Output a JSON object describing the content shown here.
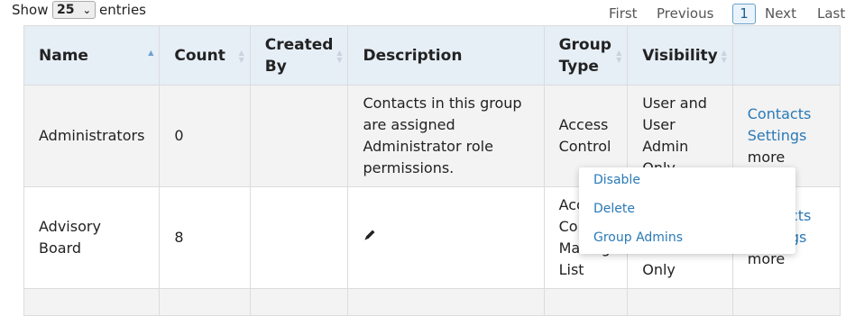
{
  "length_control": {
    "show_label": "Show",
    "value": "25",
    "entries_label": "entries"
  },
  "pagination": {
    "first": "First",
    "previous": "Previous",
    "current": "1",
    "next": "Next",
    "last": "Last"
  },
  "table": {
    "headers": {
      "name": "Name",
      "count": "Count",
      "created_by_line1": "Created",
      "created_by_line2": "By",
      "description": "Description",
      "group_type_line1": "Group",
      "group_type_line2": "Type",
      "visibility": "Visibility"
    },
    "rows": [
      {
        "name": "Administrators",
        "count": "0",
        "created_by": "",
        "description": "Contacts in this group are assigned Administrator role permissions.",
        "group_type": "Access Control",
        "visibility": "User and User Admin Only",
        "actions": {
          "contacts": "Contacts",
          "settings": "Settings",
          "more": "more"
        }
      },
      {
        "name": "Advisory Board",
        "count": "8",
        "created_by": "",
        "description_icon": "pencil-icon",
        "group_type": "Access Control Mailing List",
        "visibility": "User and User Admin Only",
        "actions": {
          "contacts": "Contacts",
          "settings": "Settings",
          "more": "more"
        }
      }
    ]
  },
  "more_menu": {
    "items": [
      "Disable",
      "Delete",
      "Group Admins"
    ]
  },
  "colors": {
    "header_bg": "#e6eef6",
    "link": "#2a7ab7",
    "row_alt": "#f3f3f3"
  }
}
